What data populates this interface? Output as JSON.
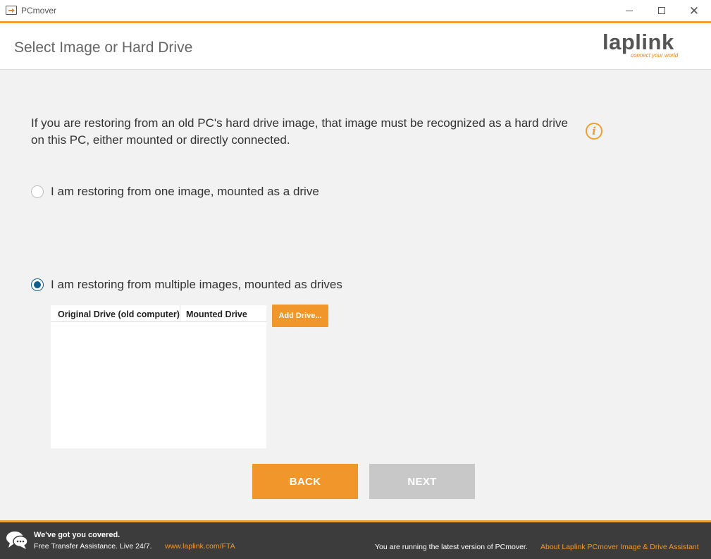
{
  "window": {
    "title": "PCmover",
    "close_glyph": "✕"
  },
  "header": {
    "page_title": "Select Image or Hard Drive",
    "logo_text": "laplink",
    "logo_tagline": "connect your world"
  },
  "content": {
    "intro": "If you are restoring from an old PC's hard drive image, that image must be recognized as a hard drive on this PC, either mounted or directly connected.",
    "info_glyph": "i",
    "options": [
      {
        "label": "I am restoring from one image, mounted as a drive",
        "checked": false
      },
      {
        "label": "I am restoring from multiple images, mounted as drives",
        "checked": true
      }
    ],
    "drive_list": {
      "columns": [
        "Original Drive (old computer)",
        "Mounted Drive"
      ],
      "rows": []
    },
    "add_drive_label": "Add Drive..."
  },
  "buttons": {
    "back": "BACK",
    "next": "NEXT"
  },
  "footer": {
    "headline": "We've got you covered.",
    "subline": "Free Transfer Assistance. Live 24/7.",
    "link": "www.laplink.com/FTA",
    "status": "You are running the latest version of PCmover.",
    "about": "About Laplink PCmover Image & Drive Assistant"
  },
  "colors": {
    "accent": "#f0962a",
    "radio_checked": "#0f5f8c",
    "disabled": "#c8c8c8",
    "footer_bg": "#3c3c3c"
  },
  "icons": [
    "app-icon",
    "minimize-icon",
    "maximize-icon",
    "close-icon",
    "info-icon",
    "chat-icon"
  ]
}
